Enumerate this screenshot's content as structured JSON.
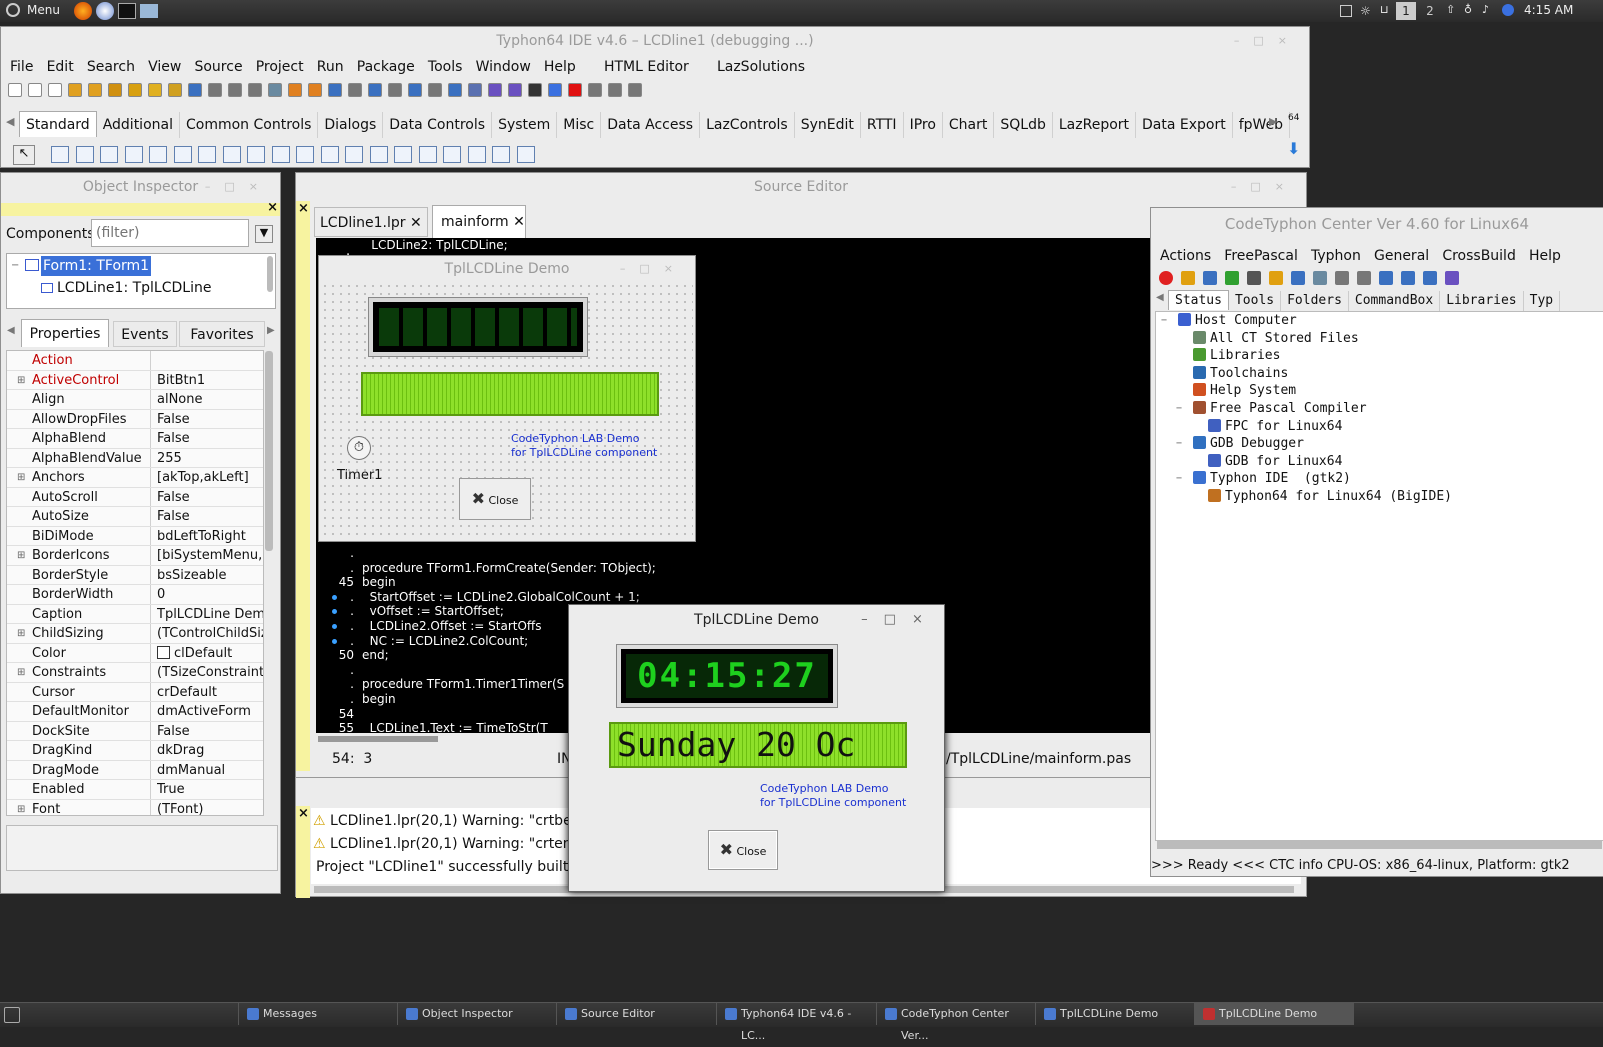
{
  "desktop": {
    "menu_label": "Menu",
    "workspaces": [
      "1",
      "2"
    ],
    "clock": "4:15 AM"
  },
  "ide": {
    "title": "Typhon64 IDE v4.6 – LCDline1 (debugging ...)",
    "menu": [
      "File",
      "Edit",
      "Search",
      "View",
      "Source",
      "Project",
      "Run",
      "Package",
      "Tools",
      "Window",
      "Help",
      "HTML Editor",
      "LazSolutions"
    ],
    "palette_tabs": [
      "Standard",
      "Additional",
      "Common Controls",
      "Dialogs",
      "Data Controls",
      "System",
      "Misc",
      "Data Access",
      "LazControls",
      "SynEdit",
      "RTTI",
      "IPro",
      "Chart",
      "SQLdb",
      "LazReport",
      "Data Export",
      "fpWeb"
    ],
    "palette_right_label": "64"
  },
  "object_inspector": {
    "title": "Object Inspector",
    "components_label": "Components",
    "filter_placeholder": "(filter)",
    "tree": [
      "Form1: TForm1",
      "LCDLine1: TplLCDLine"
    ],
    "tabs": [
      "Properties",
      "Events",
      "Favorites"
    ],
    "properties": [
      {
        "name": "Action",
        "value": "",
        "expand": false,
        "red": true
      },
      {
        "name": "ActiveControl",
        "value": "BitBtn1",
        "expand": true,
        "red": true
      },
      {
        "name": "Align",
        "value": "alNone",
        "expand": false,
        "red": false
      },
      {
        "name": "AllowDropFiles",
        "value": "False",
        "expand": false,
        "red": false
      },
      {
        "name": "AlphaBlend",
        "value": "False",
        "expand": false,
        "red": false
      },
      {
        "name": "AlphaBlendValue",
        "value": "255",
        "expand": false,
        "red": false
      },
      {
        "name": "Anchors",
        "value": "[akTop,akLeft]",
        "expand": true,
        "red": false
      },
      {
        "name": "AutoScroll",
        "value": "False",
        "expand": false,
        "red": false
      },
      {
        "name": "AutoSize",
        "value": "False",
        "expand": false,
        "red": false
      },
      {
        "name": "BiDiMode",
        "value": "bdLeftToRight",
        "expand": false,
        "red": false
      },
      {
        "name": "BorderIcons",
        "value": "[biSystemMenu,b",
        "expand": true,
        "red": false
      },
      {
        "name": "BorderStyle",
        "value": "bsSizeable",
        "expand": false,
        "red": false
      },
      {
        "name": "BorderWidth",
        "value": "0",
        "expand": false,
        "red": false
      },
      {
        "name": "Caption",
        "value": "TplLCDLine Demo",
        "expand": false,
        "red": false
      },
      {
        "name": "ChildSizing",
        "value": "(TControlChildSiz",
        "expand": true,
        "red": false
      },
      {
        "name": "Color",
        "value": "clDefault",
        "expand": false,
        "red": false
      },
      {
        "name": "Constraints",
        "value": "(TSizeConstraints",
        "expand": true,
        "red": false
      },
      {
        "name": "Cursor",
        "value": "crDefault",
        "expand": false,
        "red": false
      },
      {
        "name": "DefaultMonitor",
        "value": "dmActiveForm",
        "expand": false,
        "red": false
      },
      {
        "name": "DockSite",
        "value": "False",
        "expand": false,
        "red": false
      },
      {
        "name": "DragKind",
        "value": "dkDrag",
        "expand": false,
        "red": false
      },
      {
        "name": "DragMode",
        "value": "dmManual",
        "expand": false,
        "red": false
      },
      {
        "name": "Enabled",
        "value": "True",
        "expand": false,
        "red": false
      },
      {
        "name": "Font",
        "value": "(TFont)",
        "expand": true,
        "red": false
      }
    ]
  },
  "source_editor": {
    "title": "Source Editor",
    "tabs": [
      "LCDline1.lpr",
      "mainform"
    ],
    "top_line": "    LCDLine2: TplLCDLine;",
    "lines": [
      {
        "g": ".",
        "t": ""
      },
      {
        "g": ".",
        "t": "procedure TForm1.FormCreate(Sender: TObject);"
      },
      {
        "g": "45",
        "t": "begin"
      },
      {
        "g": ".",
        "t": "  StartOffset := LCDLine2.GlobalColCount + 1;"
      },
      {
        "g": ".",
        "t": "  vOffset := StartOffset;"
      },
      {
        "g": ".",
        "t": "  LCDLine2.Offset := StartOffs"
      },
      {
        "g": ".",
        "t": "  NC := LCDLine2.ColCount;"
      },
      {
        "g": "50",
        "t": "end;"
      },
      {
        "g": ".",
        "t": ""
      },
      {
        "g": ".",
        "t": "procedure TForm1.Timer1Timer(S"
      },
      {
        "g": ".",
        "t": "begin"
      },
      {
        "g": "54",
        "t": ""
      },
      {
        "g": "55",
        "t": "  LCDLine1.Text := TimeToStr(T"
      }
    ],
    "status_pos": "54:  3",
    "status_mode": "IN",
    "status_file": "/TplLCDLine/mainform.pas"
  },
  "design_form": {
    "title": "TplLCDLine Demo",
    "timer_label": "Timer1",
    "lab_text": [
      "CodeTyphon LAB Demo",
      "for TplLCDLine component"
    ],
    "close_label": "Close"
  },
  "messages": {
    "lines": [
      "LCDline1.lpr(20,1) Warning: \"crtbegi",
      "LCDline1.lpr(20,1) Warning: \"crtend.",
      "Project \"LCDline1\" successfully built"
    ]
  },
  "running_form": {
    "title": "TplLCDLine Demo",
    "clock": "04:15:27",
    "date": "Sunday 20 Oc",
    "lab_text": [
      "CodeTyphon LAB Demo",
      "for TplLCDLine component"
    ],
    "close_label": "Close"
  },
  "ctc": {
    "title": "CodeTyphon Center Ver 4.60 for Linux64",
    "menu": [
      "Actions",
      "FreePascal",
      "Typhon",
      "General",
      "CrossBuild",
      "Help"
    ],
    "tabs": [
      "Status",
      "Tools",
      "Folders",
      "CommandBox",
      "Libraries",
      "Typ"
    ],
    "tree": [
      {
        "indent": 0,
        "text": "Host Computer",
        "c": "#3a5fd0",
        "exp": "−"
      },
      {
        "indent": 1,
        "text": "All CT Stored Files",
        "c": "#6a8a6a",
        "exp": ""
      },
      {
        "indent": 1,
        "text": "Libraries",
        "c": "#4a9a30",
        "exp": ""
      },
      {
        "indent": 1,
        "text": "Toolchains",
        "c": "#2a6ab0",
        "exp": ""
      },
      {
        "indent": 1,
        "text": "Help System",
        "c": "#d05020",
        "exp": ""
      },
      {
        "indent": 1,
        "text": "Free Pascal Compiler",
        "c": "#a05030",
        "exp": "−"
      },
      {
        "indent": 2,
        "text": "FPC for Linux64",
        "c": "#4060c0",
        "exp": ""
      },
      {
        "indent": 1,
        "text": "GDB Debugger",
        "c": "#3070c0",
        "exp": "−"
      },
      {
        "indent": 2,
        "text": "GDB for Linux64",
        "c": "#4060c0",
        "exp": ""
      },
      {
        "indent": 1,
        "text": "Typhon IDE  (gtk2)",
        "c": "#3a70d0",
        "exp": "−"
      },
      {
        "indent": 2,
        "text": "Typhon64 for Linux64 (BigIDE)",
        "c": "#c07020",
        "exp": ""
      }
    ],
    "status": ">>> Ready <<<  CTC info CPU-OS: x86_64-linux, Platform: gtk2"
  },
  "taskbar": [
    "Messages",
    "Object Inspector",
    "Source Editor",
    "Typhon64 IDE v4.6 - LC...",
    "CodeTyphon Center Ver...",
    "TplLCDLine Demo",
    "TplLCDLine Demo"
  ]
}
